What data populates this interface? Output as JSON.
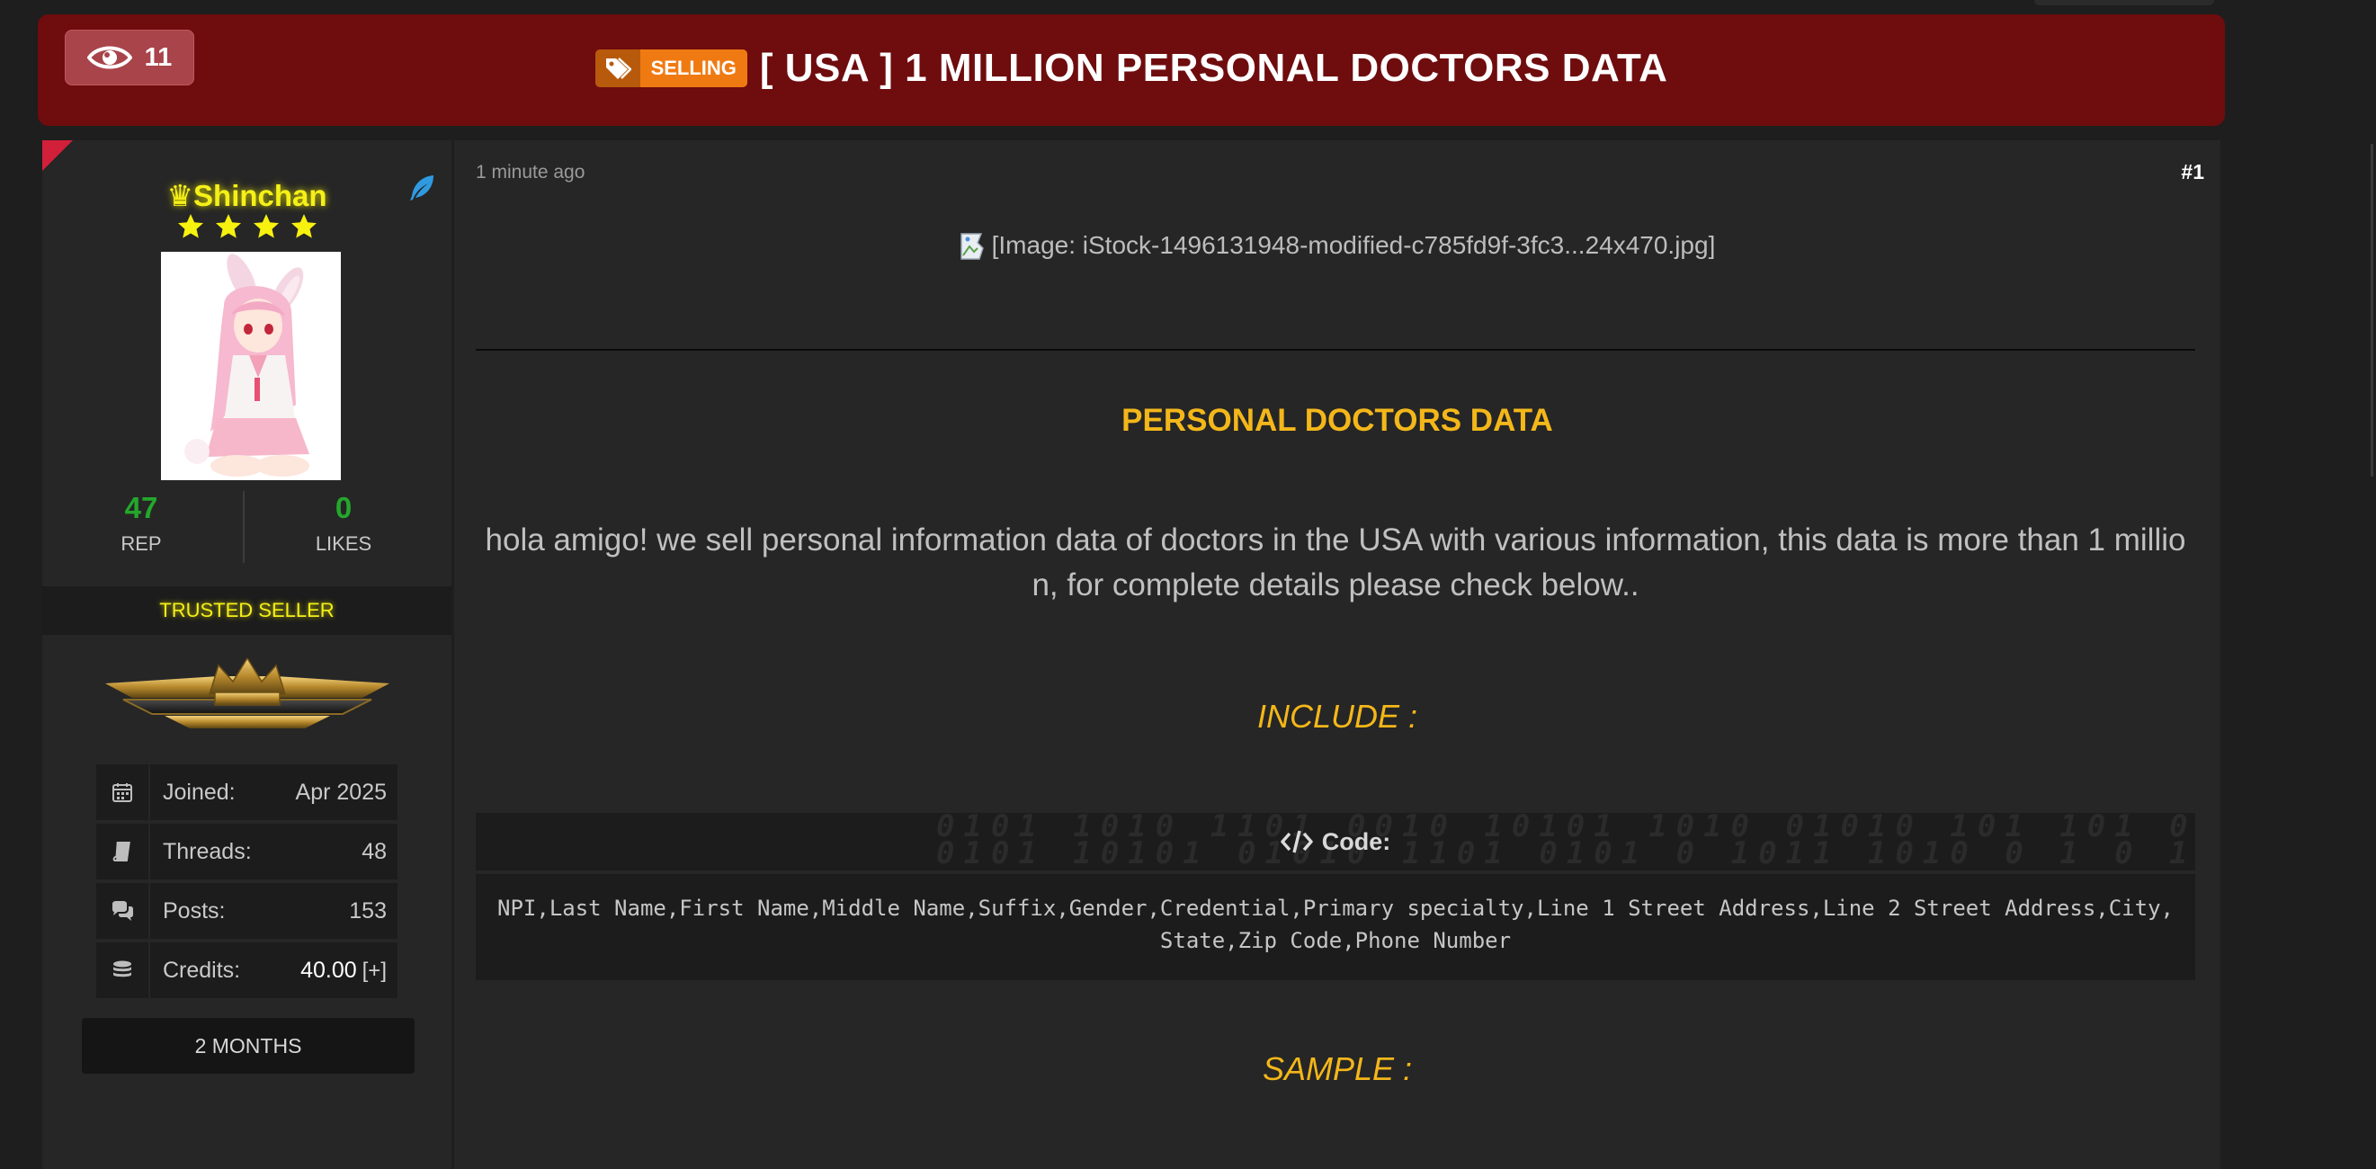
{
  "header": {
    "views_count": "11",
    "tag_label": "SELLING",
    "title": "[ USA ] 1 MILLION PERSONAL DOCTORS DATA"
  },
  "user": {
    "username": "Shinchan",
    "star_count": 4,
    "rep_value": "47",
    "rep_label": "REP",
    "likes_value": "0",
    "likes_label": "LIKES",
    "rank_title": "TRUSTED SELLER",
    "info": [
      {
        "icon": "calendar-icon",
        "label": "Joined:",
        "value": "Apr 2025"
      },
      {
        "icon": "book-icon",
        "label": "Threads:",
        "value": "48"
      },
      {
        "icon": "comments-icon",
        "label": "Posts:",
        "value": "153"
      },
      {
        "icon": "coins-icon",
        "label": "Credits:",
        "value": "40.00",
        "extra": "[+]"
      }
    ],
    "duration_badge": "2 MONTHS"
  },
  "post": {
    "time": "1 minute ago",
    "number": "#1",
    "image_alt": "[Image: iStock-1496131948-modified-c785fd9f-3fc3...24x470.jpg]",
    "heading": "PERSONAL DOCTORS DATA",
    "intro": "hola amigo! we sell personal information data of doctors in the USA with various information, this data is more than 1 million, for complete details please check below..",
    "include_label": "INCLUDE :",
    "code_label": "Code:",
    "code_content": "NPI,Last Name,First Name,Middle Name,Suffix,Gender,Credential,Primary specialty,Line 1 Street Address,Line 2 Street Address,City,State,Zip Code,Phone Number",
    "sample_label": "SAMPLE :"
  },
  "colors": {
    "header_bg": "#6f0c0e",
    "heading_gold": "#f4b71a",
    "username_yellow": "#f5f018",
    "rep_green": "#23a82b"
  }
}
